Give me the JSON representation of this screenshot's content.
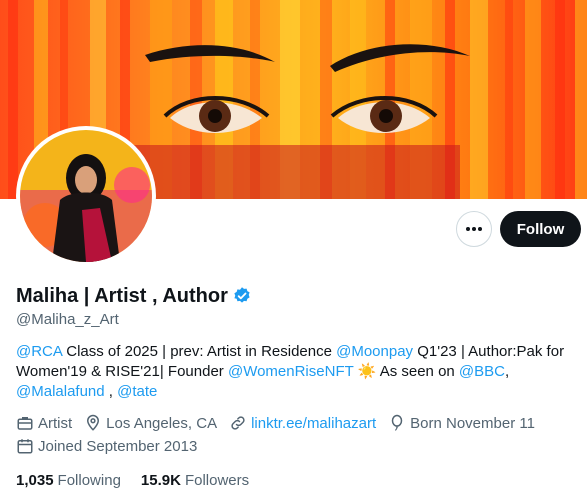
{
  "profile": {
    "display_name": "Maliha | Artist , Author",
    "handle": "@Maliha_z_Art",
    "verified_icon": "verified-badge-icon",
    "follow_label": "Follow",
    "more_icon": "more-dots-icon"
  },
  "bio": {
    "mention_rca": "@RCA",
    "text1": " Class of 2025 | prev: Artist in Residence ",
    "mention_moonpay": "@Moonpay",
    "text2": " Q1'23 | Author:Pak for Women'19 & RISE'21| Founder ",
    "mention_womenrise": "@WomenRiseNFT",
    "sun": "☀️",
    "text3": " As seen on ",
    "mention_bbc": "@BBC",
    "text4": ",",
    "mention_malala": "@Malalafund",
    "text5": " , ",
    "mention_tate": "@tate"
  },
  "meta": {
    "category": "Artist",
    "location": "Los Angeles, CA",
    "website": "linktr.ee/malihazart",
    "birthday": "Born November 11",
    "joined": "Joined September 2013"
  },
  "stats": {
    "following_count": "1,035",
    "following_label": "Following",
    "followers_count": "15.9K",
    "followers_label": "Followers"
  },
  "colors": {
    "link": "#1d9bf0",
    "text": "#0f1419",
    "muted": "#536471",
    "banner_orange": "#ff7a1a"
  }
}
